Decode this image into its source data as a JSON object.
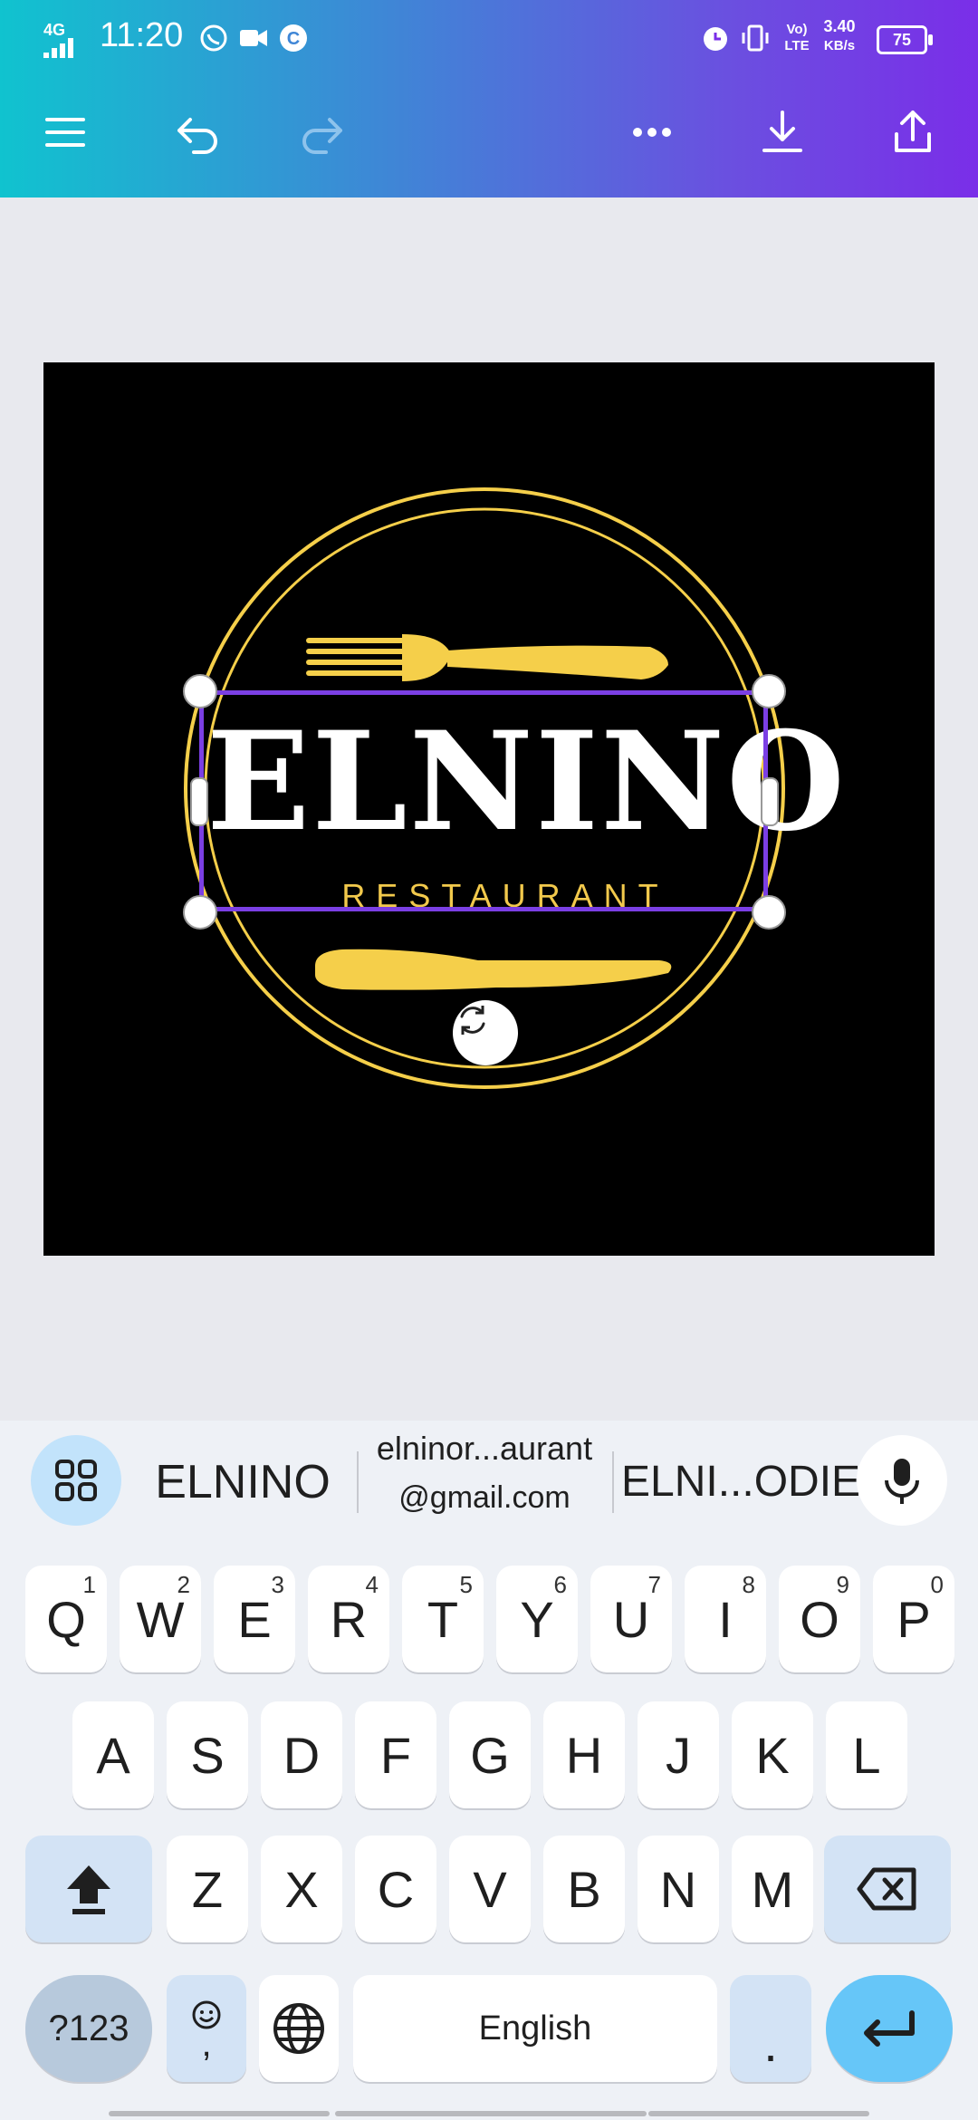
{
  "status_bar": {
    "network": "4G",
    "time": "11:20",
    "volte": "Vo) LTE",
    "speed_value": "3.40",
    "speed_unit": "KB/s",
    "battery": "75"
  },
  "toolbar": {
    "menu_icon": "hamburger-icon",
    "undo_icon": "undo-icon",
    "redo_icon": "redo-icon",
    "more_icon": "more-icon",
    "download_icon": "download-icon",
    "share_icon": "share-icon"
  },
  "design": {
    "title": "ELNINO",
    "subtitle": "RESTAURANT",
    "colors": {
      "background": "#000000",
      "gold": "#f5cf4a",
      "selection": "#7b3fe4"
    }
  },
  "keyboard": {
    "suggestions": [
      "ELNINO",
      "elninor...aurant",
      "@gmail.com",
      "ELNI...ODIE"
    ],
    "row1": [
      {
        "k": "Q",
        "h": "1"
      },
      {
        "k": "W",
        "h": "2"
      },
      {
        "k": "E",
        "h": "3"
      },
      {
        "k": "R",
        "h": "4"
      },
      {
        "k": "T",
        "h": "5"
      },
      {
        "k": "Y",
        "h": "6"
      },
      {
        "k": "U",
        "h": "7"
      },
      {
        "k": "I",
        "h": "8"
      },
      {
        "k": "O",
        "h": "9"
      },
      {
        "k": "P",
        "h": "0"
      }
    ],
    "row2": [
      "A",
      "S",
      "D",
      "F",
      "G",
      "H",
      "J",
      "K",
      "L"
    ],
    "row3": [
      "Z",
      "X",
      "C",
      "V",
      "B",
      "N",
      "M"
    ],
    "symbols_label": "?123",
    "emoji_comma": ",",
    "space_label": "English",
    "period_label": "."
  }
}
